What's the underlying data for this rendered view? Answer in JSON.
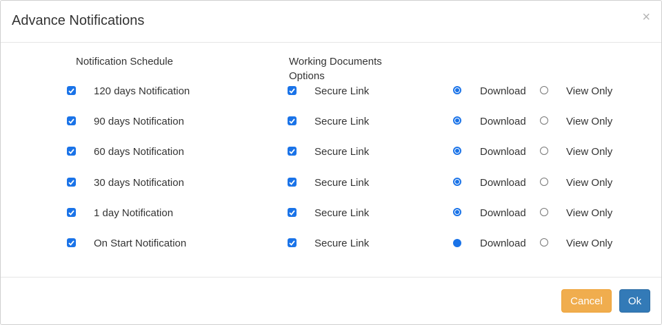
{
  "dialog": {
    "title": "Advance Notifications",
    "close_symbol": "×"
  },
  "columns": {
    "schedule_header": "Notification Schedule",
    "working_docs_header": "Working Documents Options"
  },
  "rows": [
    {
      "label": "120 days Notification",
      "checked": true,
      "secure_link_label": "Secure Link",
      "secure_checked": true,
      "download_label": "Download",
      "view_only_label": "View Only",
      "selected": "Download"
    },
    {
      "label": "90 days Notification",
      "checked": true,
      "secure_link_label": "Secure Link",
      "secure_checked": true,
      "download_label": "Download",
      "view_only_label": "View Only",
      "selected": "Download"
    },
    {
      "label": "60 days Notification",
      "checked": true,
      "secure_link_label": "Secure Link",
      "secure_checked": true,
      "download_label": "Download",
      "view_only_label": "View Only",
      "selected": "Download"
    },
    {
      "label": "30 days Notification",
      "checked": true,
      "secure_link_label": "Secure Link",
      "secure_checked": true,
      "download_label": "Download",
      "view_only_label": "View Only",
      "selected": "Download"
    },
    {
      "label": "1 day Notification",
      "checked": true,
      "secure_link_label": "Secure Link",
      "secure_checked": true,
      "download_label": "Download",
      "view_only_label": "View Only",
      "selected": "Download"
    },
    {
      "label": "On Start Notification",
      "checked": true,
      "secure_link_label": "Secure Link",
      "secure_checked": true,
      "download_label": "Download",
      "view_only_label": "View Only",
      "selected": "Download"
    }
  ],
  "footer": {
    "cancel_label": "Cancel",
    "ok_label": "Ok"
  },
  "colors": {
    "accent": "#1a73e8",
    "cancel": "#f0ad4e",
    "ok": "#337ab7"
  }
}
